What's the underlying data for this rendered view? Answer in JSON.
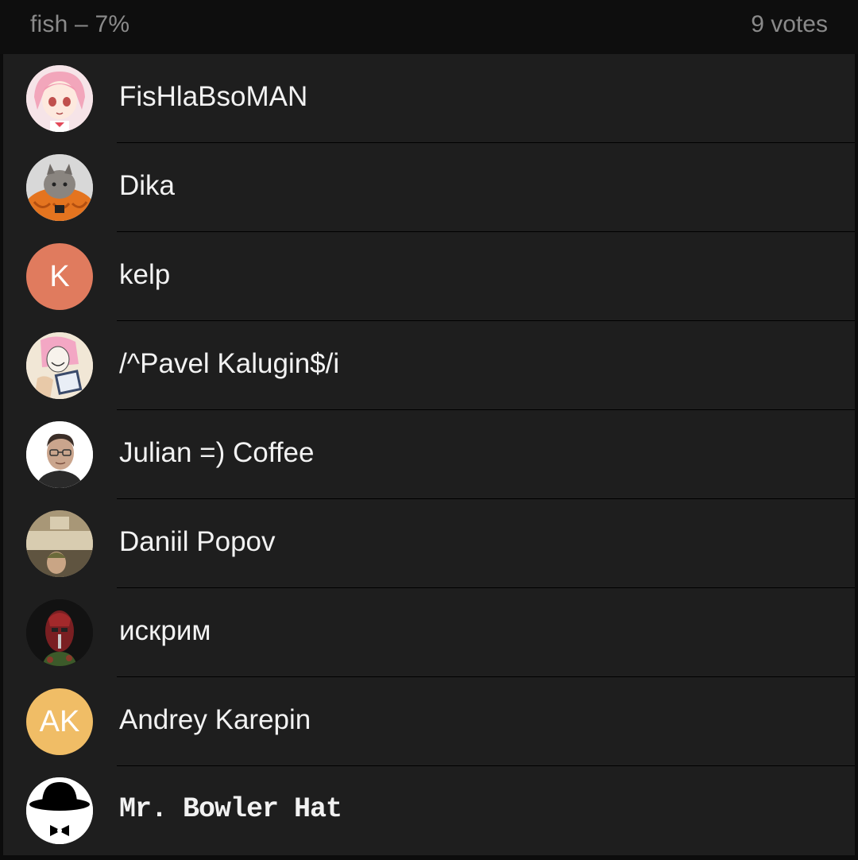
{
  "header": {
    "title": "fish – 7%",
    "votes": "9 votes"
  },
  "voters": [
    {
      "name": "FisHlaBsoMAN",
      "avatar": "anime-girl-pink-hair"
    },
    {
      "name": "Dika",
      "avatar": "cat-in-pumpkin"
    },
    {
      "name": "kelp",
      "avatar": "initials",
      "initials": "K",
      "color": "#e07b5e"
    },
    {
      "name": "/^Pavel Kalugin$/i",
      "avatar": "anime-pink-mask"
    },
    {
      "name": "Julian =) Coffee",
      "avatar": "man-portrait"
    },
    {
      "name": "Daniil Popov",
      "avatar": "traktir-sign-photo"
    },
    {
      "name": "искрим",
      "avatar": "red-mask-dark"
    },
    {
      "name": "Andrey Karepin",
      "avatar": "initials",
      "initials": "AK",
      "color": "#f0bd66"
    },
    {
      "name": "Mr. Bowler Hat",
      "avatar": "bowler-hat-bowtie"
    }
  ],
  "colors": {
    "background": "#1e1e1e",
    "header_background": "#0e0e0e",
    "header_text": "#8a8a8a",
    "name_text": "#f2f2f2"
  }
}
